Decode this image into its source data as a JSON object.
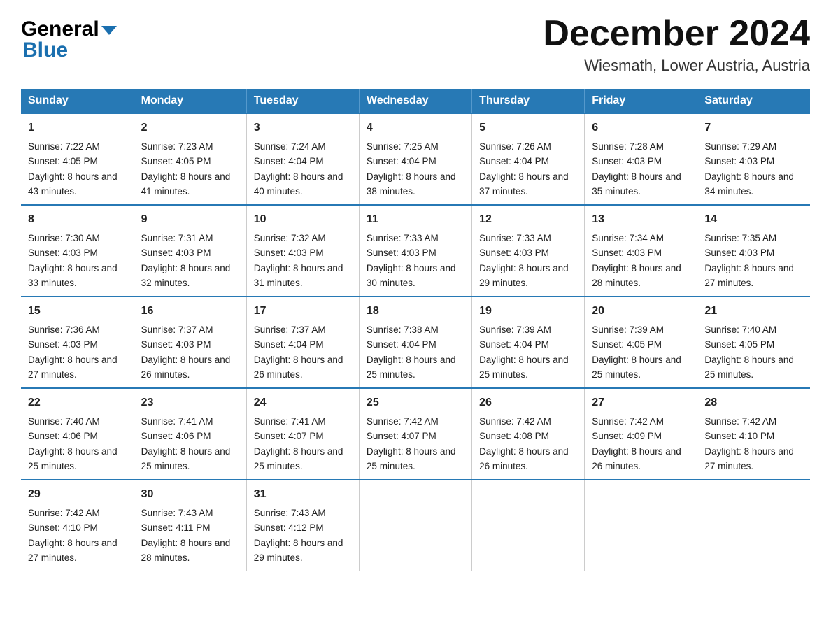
{
  "header": {
    "logo_general": "General",
    "logo_blue": "Blue",
    "month_title": "December 2024",
    "location": "Wiesmath, Lower Austria, Austria"
  },
  "days_of_week": [
    "Sunday",
    "Monday",
    "Tuesday",
    "Wednesday",
    "Thursday",
    "Friday",
    "Saturday"
  ],
  "weeks": [
    [
      {
        "day": "1",
        "sunrise": "7:22 AM",
        "sunset": "4:05 PM",
        "daylight": "8 hours and 43 minutes."
      },
      {
        "day": "2",
        "sunrise": "7:23 AM",
        "sunset": "4:05 PM",
        "daylight": "8 hours and 41 minutes."
      },
      {
        "day": "3",
        "sunrise": "7:24 AM",
        "sunset": "4:04 PM",
        "daylight": "8 hours and 40 minutes."
      },
      {
        "day": "4",
        "sunrise": "7:25 AM",
        "sunset": "4:04 PM",
        "daylight": "8 hours and 38 minutes."
      },
      {
        "day": "5",
        "sunrise": "7:26 AM",
        "sunset": "4:04 PM",
        "daylight": "8 hours and 37 minutes."
      },
      {
        "day": "6",
        "sunrise": "7:28 AM",
        "sunset": "4:03 PM",
        "daylight": "8 hours and 35 minutes."
      },
      {
        "day": "7",
        "sunrise": "7:29 AM",
        "sunset": "4:03 PM",
        "daylight": "8 hours and 34 minutes."
      }
    ],
    [
      {
        "day": "8",
        "sunrise": "7:30 AM",
        "sunset": "4:03 PM",
        "daylight": "8 hours and 33 minutes."
      },
      {
        "day": "9",
        "sunrise": "7:31 AM",
        "sunset": "4:03 PM",
        "daylight": "8 hours and 32 minutes."
      },
      {
        "day": "10",
        "sunrise": "7:32 AM",
        "sunset": "4:03 PM",
        "daylight": "8 hours and 31 minutes."
      },
      {
        "day": "11",
        "sunrise": "7:33 AM",
        "sunset": "4:03 PM",
        "daylight": "8 hours and 30 minutes."
      },
      {
        "day": "12",
        "sunrise": "7:33 AM",
        "sunset": "4:03 PM",
        "daylight": "8 hours and 29 minutes."
      },
      {
        "day": "13",
        "sunrise": "7:34 AM",
        "sunset": "4:03 PM",
        "daylight": "8 hours and 28 minutes."
      },
      {
        "day": "14",
        "sunrise": "7:35 AM",
        "sunset": "4:03 PM",
        "daylight": "8 hours and 27 minutes."
      }
    ],
    [
      {
        "day": "15",
        "sunrise": "7:36 AM",
        "sunset": "4:03 PM",
        "daylight": "8 hours and 27 minutes."
      },
      {
        "day": "16",
        "sunrise": "7:37 AM",
        "sunset": "4:03 PM",
        "daylight": "8 hours and 26 minutes."
      },
      {
        "day": "17",
        "sunrise": "7:37 AM",
        "sunset": "4:04 PM",
        "daylight": "8 hours and 26 minutes."
      },
      {
        "day": "18",
        "sunrise": "7:38 AM",
        "sunset": "4:04 PM",
        "daylight": "8 hours and 25 minutes."
      },
      {
        "day": "19",
        "sunrise": "7:39 AM",
        "sunset": "4:04 PM",
        "daylight": "8 hours and 25 minutes."
      },
      {
        "day": "20",
        "sunrise": "7:39 AM",
        "sunset": "4:05 PM",
        "daylight": "8 hours and 25 minutes."
      },
      {
        "day": "21",
        "sunrise": "7:40 AM",
        "sunset": "4:05 PM",
        "daylight": "8 hours and 25 minutes."
      }
    ],
    [
      {
        "day": "22",
        "sunrise": "7:40 AM",
        "sunset": "4:06 PM",
        "daylight": "8 hours and 25 minutes."
      },
      {
        "day": "23",
        "sunrise": "7:41 AM",
        "sunset": "4:06 PM",
        "daylight": "8 hours and 25 minutes."
      },
      {
        "day": "24",
        "sunrise": "7:41 AM",
        "sunset": "4:07 PM",
        "daylight": "8 hours and 25 minutes."
      },
      {
        "day": "25",
        "sunrise": "7:42 AM",
        "sunset": "4:07 PM",
        "daylight": "8 hours and 25 minutes."
      },
      {
        "day": "26",
        "sunrise": "7:42 AM",
        "sunset": "4:08 PM",
        "daylight": "8 hours and 26 minutes."
      },
      {
        "day": "27",
        "sunrise": "7:42 AM",
        "sunset": "4:09 PM",
        "daylight": "8 hours and 26 minutes."
      },
      {
        "day": "28",
        "sunrise": "7:42 AM",
        "sunset": "4:10 PM",
        "daylight": "8 hours and 27 minutes."
      }
    ],
    [
      {
        "day": "29",
        "sunrise": "7:42 AM",
        "sunset": "4:10 PM",
        "daylight": "8 hours and 27 minutes."
      },
      {
        "day": "30",
        "sunrise": "7:43 AM",
        "sunset": "4:11 PM",
        "daylight": "8 hours and 28 minutes."
      },
      {
        "day": "31",
        "sunrise": "7:43 AM",
        "sunset": "4:12 PM",
        "daylight": "8 hours and 29 minutes."
      },
      null,
      null,
      null,
      null
    ]
  ],
  "labels": {
    "sunrise": "Sunrise:",
    "sunset": "Sunset:",
    "daylight": "Daylight:"
  }
}
